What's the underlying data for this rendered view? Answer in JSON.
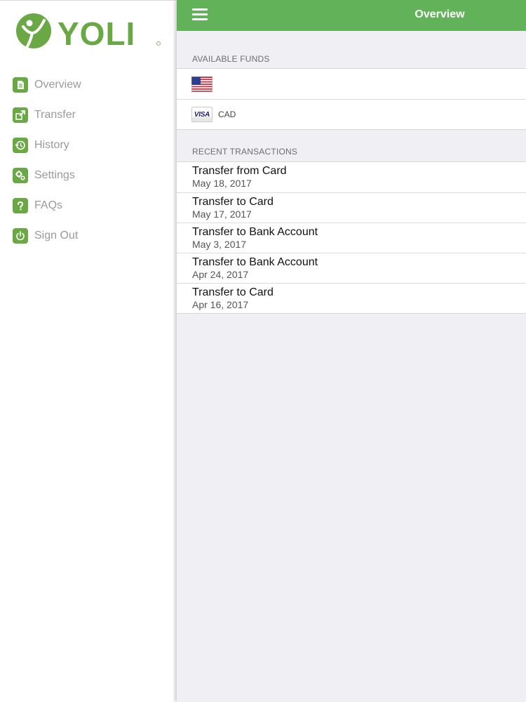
{
  "app": {
    "brand": "YOLI"
  },
  "sidebar": {
    "items": [
      {
        "label": "Overview",
        "icon": "document-icon"
      },
      {
        "label": "Transfer",
        "icon": "transfer-icon"
      },
      {
        "label": "History",
        "icon": "history-icon"
      },
      {
        "label": "Settings",
        "icon": "gear-icon"
      },
      {
        "label": "FAQs",
        "icon": "question-icon"
      },
      {
        "label": "Sign Out",
        "icon": "power-icon"
      }
    ]
  },
  "header": {
    "title": "Overview"
  },
  "funds": {
    "header": "AVAILABLE FUNDS",
    "items": [
      {
        "icon": "us-flag-icon",
        "currency": ""
      },
      {
        "icon": "visa-card-icon",
        "card_brand": "VISA",
        "currency": "CAD"
      }
    ]
  },
  "transactions": {
    "header": "RECENT TRANSACTIONS",
    "items": [
      {
        "title": "Transfer from Card",
        "date": "May 18, 2017"
      },
      {
        "title": "Transfer to Card",
        "date": "May 17, 2017"
      },
      {
        "title": "Transfer to Bank Account",
        "date": "May 3, 2017"
      },
      {
        "title": "Transfer to Bank Account",
        "date": "Apr 24, 2017"
      },
      {
        "title": "Transfer to Card",
        "date": "Apr 16, 2017"
      }
    ]
  },
  "colors": {
    "brand_green": "#6aa845",
    "topbar_green": "#62b25a",
    "background_gray": "#efeff4"
  }
}
